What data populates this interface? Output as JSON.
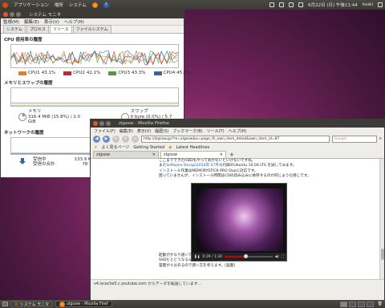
{
  "top_panel": {
    "menus": [
      "アプリケーション",
      "場所",
      "システム"
    ],
    "datetime": "6月22日 (日) 午後11:44",
    "user": "tsuki"
  },
  "sysmon": {
    "title": "システム モニタ",
    "menubar": [
      "監視(M)",
      "編集(E)",
      "表示(V)",
      "ヘルプ(H)"
    ],
    "tabs": [
      "システム",
      "プロセス",
      "リソース",
      "ファイルシステム"
    ],
    "active_tab": "リソース",
    "cpu": {
      "title": "CPU 使用率の履歴",
      "series": [
        {
          "name": "CPU1",
          "value": "43.1%",
          "color": "#ef7b29"
        },
        {
          "name": "CPU2",
          "value": "42.1%",
          "color": "#c0262d"
        },
        {
          "name": "CPU3",
          "value": "43.3%",
          "color": "#4f9a3a"
        },
        {
          "name": "CPU4",
          "value": "45.8%",
          "color": "#3465a4"
        }
      ],
      "y_labels": [
        "100 %",
        "50 %",
        "0 %"
      ]
    },
    "memory": {
      "title": "メモリとスワップの履歴",
      "mem_label": "メモリ",
      "mem_value": "316.4 MiB (15.8%) / 2.0 GiB",
      "swap_label": "スワップ",
      "swap_value": "0 byte (0.0%) / 5.7 GiB"
    },
    "network": {
      "title": "ネットワークの履歴",
      "recv_label": "受信中",
      "recv_total_label": "受信の合計",
      "recv_value": "133.9 KiB/秒",
      "recv_total": "78.7 MiB"
    }
  },
  "firefox": {
    "title": "zigsow - Mozilla Firefox",
    "menubar": [
      "ファイル(F)",
      "編集(E)",
      "表示(V)",
      "履歴(S)",
      "ブックマーク(B)",
      "ツール(T)",
      "ヘルプ(H)"
    ],
    "url": "http://zigsow.jp/?m=zigsow&a=page_fh_own_item_detail&own_item_id=87",
    "search_placeholder": "Google",
    "bookmarks": [
      "よく見るページ",
      "Getting Started",
      "Latest Headlines"
    ],
    "tabs": [
      "zigsow",
      "zigsow"
    ],
    "article_lines": [
      "ここまでできたHDDもやっておかないといけないですね。",
      "またSoftware Design2010年 07月号付録のUbuntu 10.04 LTS を試してみます。",
      "インストール作業はMEMORYSTICK PRO Duoに対応です。",
      "困っていませんが、インストール時間はCDの読み込みに依存するのか同じような感じです。"
    ],
    "article_link": "Software Design2010年 07月号",
    "video_time": "0:39 / 1:30",
    "video_progress": 0.43,
    "article_lines_2": [
      "起動がかなり速いですね。",
      "SSDだとどうなるんでしょうね?",
      "",
      "容量が十分あるので使い方を考えます。[画面]"
    ],
    "status": "v4.lscache5.c.youtube.com からデータを転送しています..."
  },
  "bottom_panel": {
    "tasks": [
      "システム モニタ",
      "zigsow - Mozilla Firef"
    ]
  }
}
